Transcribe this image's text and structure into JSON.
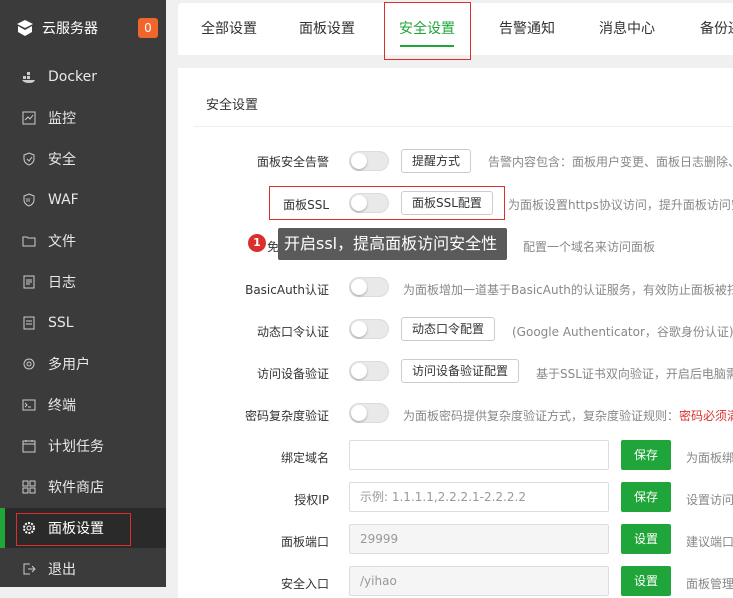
{
  "sidebar": {
    "brand": "云服务器",
    "badge": "0",
    "items": [
      {
        "label": "Docker",
        "icon": "docker-icon"
      },
      {
        "label": "监控",
        "icon": "monitor-icon"
      },
      {
        "label": "安全",
        "icon": "shield-icon"
      },
      {
        "label": "WAF",
        "icon": "waf-icon"
      },
      {
        "label": "文件",
        "icon": "folder-icon"
      },
      {
        "label": "日志",
        "icon": "log-icon"
      },
      {
        "label": "SSL",
        "icon": "ssl-icon"
      },
      {
        "label": "多用户",
        "icon": "users-icon"
      },
      {
        "label": "终端",
        "icon": "terminal-icon"
      },
      {
        "label": "计划任务",
        "icon": "calendar-icon"
      },
      {
        "label": "软件商店",
        "icon": "store-icon"
      },
      {
        "label": "面板设置",
        "icon": "gear-icon",
        "active": true
      },
      {
        "label": "退出",
        "icon": "logout-icon"
      }
    ]
  },
  "tabs": [
    "全部设置",
    "面板设置",
    "安全设置",
    "告警通知",
    "消息中心",
    "备份还"
  ],
  "active_tab": "安全设置",
  "panel": {
    "title": "安全设置",
    "rows": {
      "alarm": {
        "label": "面板安全告警",
        "button": "提醒方式",
        "desc": "告警内容包含：面板用户变更、面板日志删除、"
      },
      "ssl": {
        "label": "面板SSL",
        "button": "面板SSL配置",
        "desc": "为面板设置https协议访问，提升面板访问安"
      },
      "domain_hint": {
        "label": "免",
        "desc": "配置一个域名来访问面板"
      },
      "basicauth": {
        "label": "BasicAuth认证",
        "desc": "为面板增加一道基于BasicAuth的认证服务，有效防止面板被扫"
      },
      "totp": {
        "label": "动态口令认证",
        "button": "动态口令配置",
        "desc": "(Google Authenticator，谷歌身份认证)"
      },
      "device": {
        "label": "访问设备验证",
        "button": "访问设备验证配置",
        "desc": "基于SSL证书双向验证，开启后电脑需"
      },
      "pwd": {
        "label": "密码复杂度验证",
        "desc": "为面板密码提供复杂度验证方式，复杂度验证规则：",
        "desc_red": "密码必须满"
      },
      "bind_domain": {
        "label": "绑定域名",
        "value": "",
        "button": "保存",
        "desc": "为面板绑"
      },
      "auth_ip": {
        "label": "授权IP",
        "placeholder": "示例: 1.1.1.1,2.2.2.1-2.2.2.2",
        "button": "保存",
        "desc": "设置访问"
      },
      "port": {
        "label": "面板端口",
        "value": "29999",
        "button": "设置",
        "desc": "建议端口"
      },
      "entry": {
        "label": "安全入口",
        "value": "/yihao",
        "button": "设置",
        "desc": "面板管理"
      }
    }
  },
  "tooltip": {
    "number": "1",
    "text": "开启ssl，提高面板访问安全性"
  },
  "colors": {
    "accent": "#20a53a",
    "sidebar": "#3b3b3b",
    "highlight": "#d9302d",
    "badge": "#f0662d"
  }
}
